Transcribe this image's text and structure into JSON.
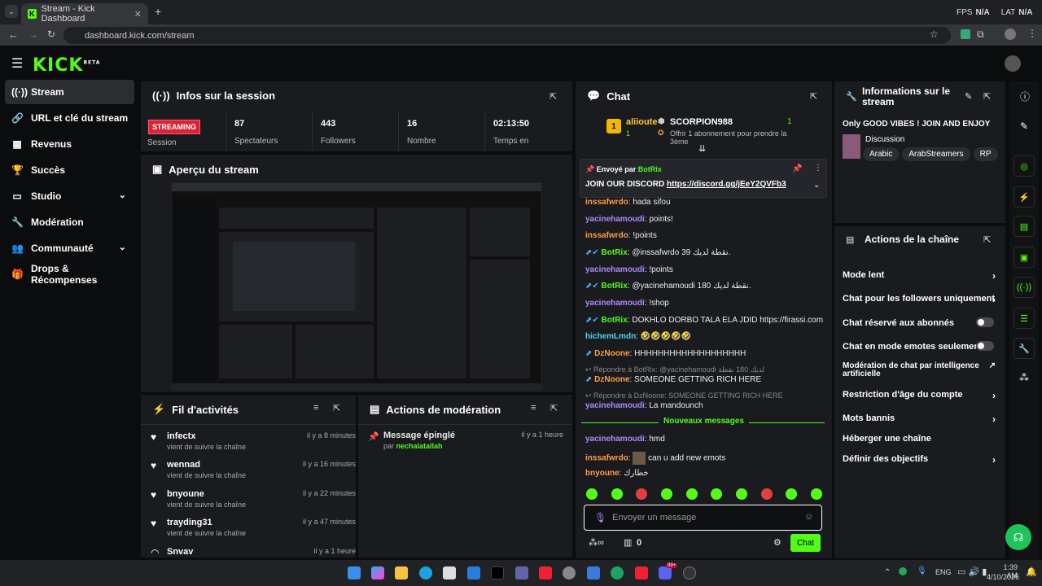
{
  "browser": {
    "tab_title": "Stream - Kick Dashboard",
    "url": "dashboard.kick.com/stream",
    "fps_label": "FPS",
    "fps_value": "N/A",
    "lat_label": "LAT",
    "lat_value": "N/A"
  },
  "header": {
    "logo": "KICK",
    "logo_badge": "BETA"
  },
  "sidebar": {
    "items": [
      {
        "label": "Stream",
        "active": true
      },
      {
        "label": "URL et clé du stream"
      },
      {
        "label": "Revenus"
      },
      {
        "label": "Succès"
      },
      {
        "label": "Studio",
        "expandable": true
      },
      {
        "label": "Modération"
      },
      {
        "label": "Communauté",
        "expandable": true
      },
      {
        "label": "Drops & Récompenses"
      }
    ]
  },
  "session": {
    "title": "Infos sur la session",
    "status": "STREAMING",
    "session_label": "Session",
    "stats": [
      {
        "value": "87",
        "label": "Spectateurs"
      },
      {
        "value": "443",
        "label": "Followers"
      },
      {
        "value": "16",
        "label": "Nombre"
      },
      {
        "value": "02:13:50",
        "label": "Temps en"
      }
    ]
  },
  "preview": {
    "title": "Aperçu du stream"
  },
  "activity": {
    "title": "Fil d'activités",
    "items": [
      {
        "name": "infectx",
        "sub": "vient de suivre la chaîne",
        "time": "il y a 8 minutes"
      },
      {
        "name": "wennad",
        "sub": "vient de suivre la chaîne",
        "time": "il y a 16 minutes"
      },
      {
        "name": "bnyoune",
        "sub": "vient de suivre la chaîne",
        "time": "il y a 22 minutes"
      },
      {
        "name": "trayding31",
        "sub": "vient de suivre la chaîne",
        "time": "il y a 47 minutes"
      },
      {
        "name": "Snvav",
        "sub": "",
        "time": "il y a 1 heure"
      }
    ]
  },
  "moderation": {
    "title": "Actions de modération",
    "item": {
      "name": "Message épinglé",
      "by_label": "par",
      "by": "nechalatallah",
      "time": "il y a 1 heure"
    }
  },
  "chat": {
    "title": "Chat",
    "leaderboard": {
      "rank1_name": "aliioute",
      "rank1_count": "1",
      "rank2_name": "SCORPION988",
      "rank2_count": "1",
      "offer": "Offrir 1 abonnement pour prendre la 3ème"
    },
    "pinned": {
      "sent_by": "Envoyé par",
      "bot": "BotRix",
      "text": "JOIN OUR DISCORD",
      "link": "https://discord.gg/jEeY2QVFb3"
    },
    "messages": [
      {
        "user": "inssafwrdo",
        "text": "hada sifou",
        "color": "orange"
      },
      {
        "user": "yacinehamoudi",
        "text": "points!",
        "color": "purple"
      },
      {
        "user": "inssafwrdo",
        "text": "!points",
        "color": "orange"
      },
      {
        "user": "BotRix",
        "text": "@inssafwrdo 39 نقطة لديك.",
        "color": "green"
      },
      {
        "user": "yacinehamoudi",
        "text": "!points",
        "color": "purple"
      },
      {
        "user": "BotRix",
        "text": "@yacinehamoudi 180 نقطة لديك.",
        "color": "green"
      },
      {
        "user": "yacinehamoudi",
        "text": "!shop",
        "color": "purple"
      },
      {
        "user": "BotRix",
        "text": "DOKHLO DORBO TALA ELA JDID https://firassi.com",
        "color": "green"
      },
      {
        "user": "hichemLmdn",
        "text": "🤣🤣🤣🤣🤣",
        "color": "cyan"
      },
      {
        "user": "DzNoone",
        "text": "HHHHHHHHHHHHHHHHHHH",
        "color": "orange"
      }
    ],
    "reply1": "Répondre à BotRix: @yacinehamoudi لديك 180 نقطة",
    "reply1_user": "DzNoone",
    "reply1_text": "SOMEONE GETTING RICH HERE",
    "reply2": "Répondre à DzNoone: SOMEONE GETTING RICH HERE",
    "reply2_user": "yacinehamoudi",
    "reply2_text": "La mandounch",
    "new_messages": "Nouveaux messages",
    "messages2": [
      {
        "user": "yacinehamoudi",
        "text": "hmd",
        "color": "purple"
      },
      {
        "user": "inssafwrdo",
        "text": "can u add new emots",
        "color": "orange"
      },
      {
        "user": "bnyoune",
        "text": "خطارك",
        "color": "orange"
      }
    ],
    "input_placeholder": "Envoyer un message",
    "points": "0",
    "send": "Chat"
  },
  "stream_info": {
    "title": "Informations sur le stream",
    "stream_title": "Only GOOD VIBES ! JOIN AND ENJOY",
    "category": "Discussion",
    "tags": [
      "Arabic",
      "ArabStreamers",
      "RP"
    ]
  },
  "channel_actions": {
    "title": "Actions de la chaîne",
    "items": [
      {
        "label": "Mode lent",
        "control": "chevron"
      },
      {
        "label": "Chat pour les followers uniquement",
        "control": "chevron"
      },
      {
        "label": "Chat réservé aux abonnés",
        "control": "toggle"
      },
      {
        "label": "Chat en mode emotes seulement",
        "control": "toggle"
      },
      {
        "label": "Modération de chat par intelligence artificielle",
        "control": "external"
      },
      {
        "label": "Restriction d'âge du compte",
        "control": "chevron"
      },
      {
        "label": "Mots bannis",
        "control": "chevron"
      },
      {
        "label": "Héberger une chaîne",
        "control": "none"
      },
      {
        "label": "Définir des objectifs",
        "control": "chevron"
      }
    ]
  },
  "taskbar": {
    "lang": "ENG",
    "time": "1:39 AM",
    "date": "4/10/2026",
    "badge": "99+"
  }
}
